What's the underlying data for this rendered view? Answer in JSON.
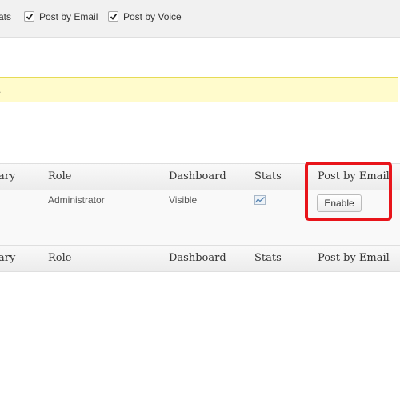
{
  "screen_options": {
    "items": [
      {
        "label": "ats",
        "checked": true
      },
      {
        "label": "Post by Email",
        "checked": true
      },
      {
        "label": "Post by Voice",
        "checked": true
      }
    ]
  },
  "notice": {
    "text": "."
  },
  "table": {
    "columns": [
      "ary",
      "Role",
      "Dashboard",
      "Stats",
      "Post by Email"
    ],
    "row": {
      "role": "Administrator",
      "dashboard": "Visible",
      "stats_icon": "stats-chart-icon",
      "post_by_email_button": "Enable"
    }
  },
  "colors": {
    "highlight": "#e8141a",
    "notice_bg": "#fffbcc"
  }
}
